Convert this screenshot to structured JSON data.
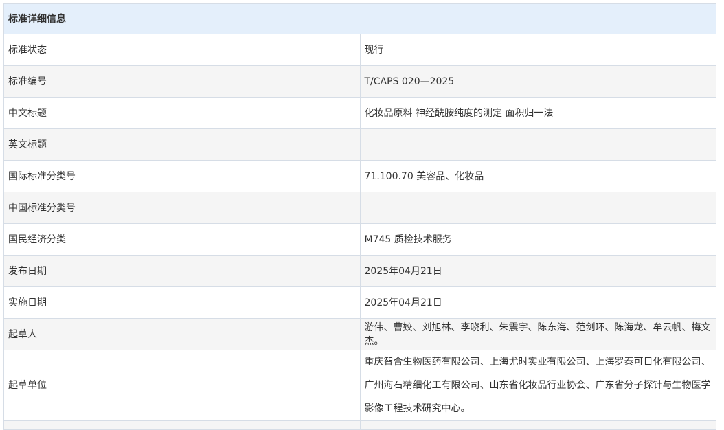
{
  "header": {
    "title": "标准详细信息"
  },
  "rows": [
    {
      "label": "标准状态",
      "value": "现行"
    },
    {
      "label": "标准编号",
      "value": "T/CAPS 020—2025"
    },
    {
      "label": "中文标题",
      "value": "化妆品原料 神经酰胺纯度的测定 面积归一法"
    },
    {
      "label": "英文标题",
      "value": ""
    },
    {
      "label": "国际标准分类号",
      "value": "71.100.70 美容品、化妆品"
    },
    {
      "label": "中国标准分类号",
      "value": ""
    },
    {
      "label": "国民经济分类",
      "value": "M745 质检技术服务"
    },
    {
      "label": "发布日期",
      "value": "2025年04月21日"
    },
    {
      "label": "实施日期",
      "value": "2025年04月21日"
    },
    {
      "label": "起草人",
      "value": "游伟、曹姣、刘旭林、李晓利、朱震宇、陈东海、范剑环、陈海龙、牟云帆、梅文杰。"
    },
    {
      "label": "起草单位",
      "value": "重庆智合生物医药有限公司、上海尤时实业有限公司、上海罗泰可日化有限公司、广州海石精细化工有限公司、山东省化妆品行业协会、广东省分子探针与生物医学影像工程技术研究中心。"
    }
  ]
}
